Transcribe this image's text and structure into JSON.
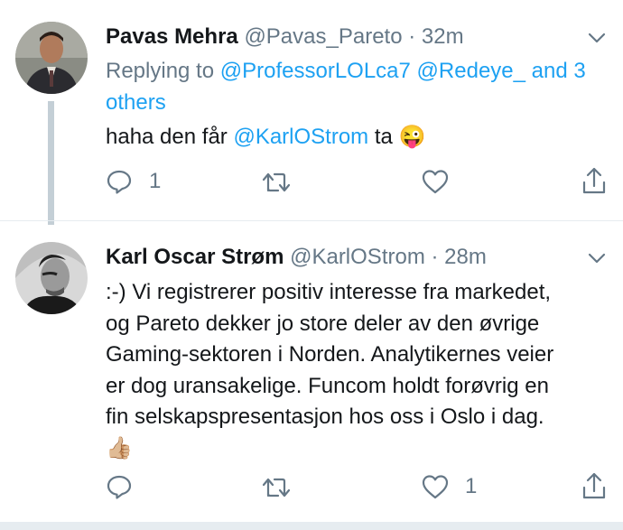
{
  "tweets": [
    {
      "display_name": "Pavas Mehra",
      "handle": "@Pavas_Pareto",
      "separator": "·",
      "time": "32m",
      "reply_prefix": "Replying to",
      "reply_to": [
        "@ProfessorLOLca7",
        "@Redeye_",
        "and",
        "3 others"
      ],
      "text_before": "haha den får",
      "mention": "@KarlOStrom",
      "text_after": "ta",
      "emoji": "😜",
      "actions": {
        "reply_count": "1",
        "retweet_count": "",
        "like_count": ""
      }
    },
    {
      "display_name": "Karl Oscar Strøm",
      "handle": "@KarlOStrom",
      "separator": "·",
      "time": "28m",
      "lines": [
        ":-) Vi registrerer positiv interesse fra markedet,",
        "og Pareto dekker jo store deler av den øvrige",
        "Gaming-sektoren i Norden. Analytikernes veier",
        "er dog uransakelige. Funcom holdt forøvrig en",
        "fin selskapspresentasjon hos oss i Oslo i dag."
      ],
      "emoji": "👍🏼",
      "actions": {
        "reply_count": "",
        "retweet_count": "",
        "like_count": "1"
      }
    }
  ],
  "colors": {
    "link": "#1da1f2",
    "muted": "#657786",
    "text": "#14171a",
    "thread_line": "#c4cfd6"
  }
}
